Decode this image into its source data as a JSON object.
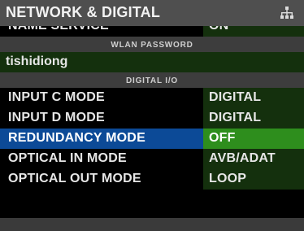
{
  "header": {
    "title": "NETWORK & DIGITAL",
    "icon": "network-icon"
  },
  "partial_row": {
    "label": "NAME SERVICE",
    "value": "ON"
  },
  "wlan": {
    "header": "WLAN PASSWORD",
    "password": "tishidiong"
  },
  "digital_io": {
    "header": "DIGITAL I/O",
    "rows": [
      {
        "label": "INPUT C MODE",
        "value": "DIGITAL"
      },
      {
        "label": "INPUT D MODE",
        "value": "DIGITAL"
      },
      {
        "label": "REDUNDANCY MODE",
        "value": "OFF"
      },
      {
        "label": "OPTICAL IN MODE",
        "value": "AVB/ADAT"
      },
      {
        "label": "OPTICAL OUT MODE",
        "value": "LOOP"
      }
    ]
  },
  "colors": {
    "title_bar": "#4f4f4f",
    "section_header": "#3d3d3d",
    "value_cell": "#14300d",
    "selected_row": "#0c4a97",
    "selected_value": "#2e8e1d"
  }
}
